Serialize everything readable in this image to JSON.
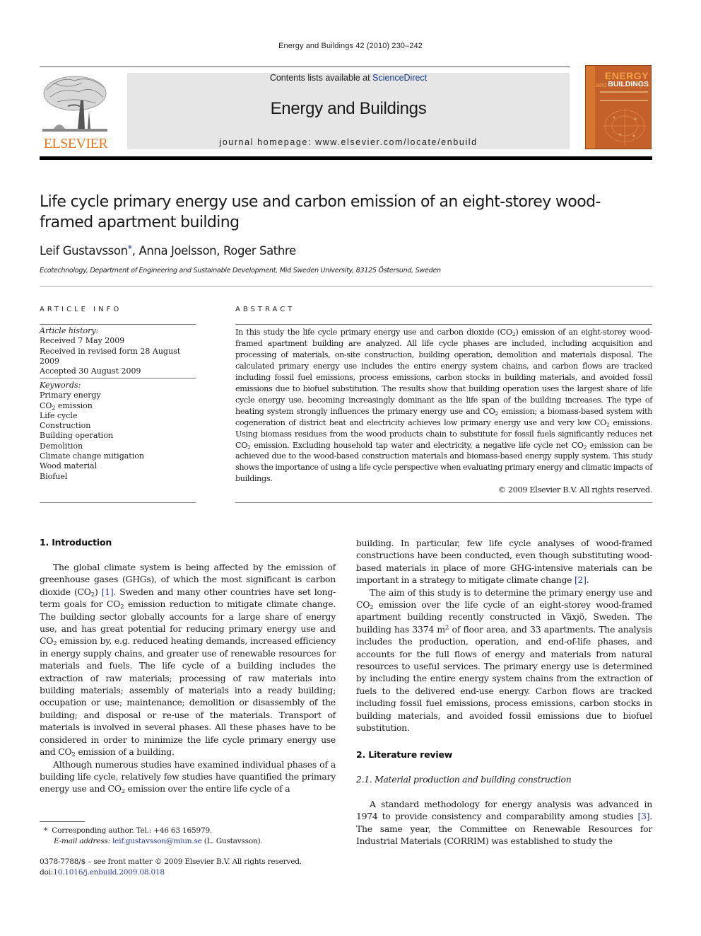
{
  "running_head": "Energy and Buildings 42 (2010) 230–242",
  "banner": {
    "contents_prefix": "Contents lists available at ",
    "contents_link": "ScienceDirect",
    "journal_title": "Energy and Buildings",
    "homepage": "journal homepage: www.elsevier.com/locate/enbuild"
  },
  "publisher_logo": {
    "icon": "elsevier-tree-icon",
    "wordmark": "ELSEVIER"
  },
  "cover": {
    "title_line1": "ENERGY",
    "title_and": "and",
    "title_line2": "BUILDINGS"
  },
  "article": {
    "title": "Life cycle primary energy use and carbon emission of an eight-storey wood-framed apartment building",
    "authors": [
      {
        "name": "Leif Gustavsson",
        "corresponding_mark": "*"
      },
      {
        "name": "Anna Joelsson"
      },
      {
        "name": "Roger Sathre"
      }
    ],
    "affiliation": "Ecotechnology, Department of Engineering and Sustainable Development, Mid Sweden University, 83125 Östersund, Sweden"
  },
  "article_info": {
    "label": "ARTICLE INFO",
    "history_label": "Article history:",
    "history": [
      "Received 7 May 2009",
      "Received in revised form 28 August 2009",
      "Accepted 30 August 2009"
    ],
    "keywords_label": "Keywords:",
    "keywords": [
      "Primary energy",
      "CO2 emission",
      "Life cycle",
      "Construction",
      "Building operation",
      "Demolition",
      "Climate change mitigation",
      "Wood material",
      "Biofuel"
    ]
  },
  "abstract": {
    "label": "ABSTRACT",
    "text": "In this study the life cycle primary energy use and carbon dioxide (CO2) emission of an eight-storey wood-framed apartment building are analyzed. All life cycle phases are included, including acquisition and processing of materials, on-site construction, building operation, demolition and materials disposal. The calculated primary energy use includes the entire energy system chains, and carbon flows are tracked including fossil fuel emissions, process emissions, carbon stocks in building materials, and avoided fossil emissions due to biofuel substitution. The results show that building operation uses the largest share of life cycle energy use, becoming increasingly dominant as the life span of the building increases. The type of heating system strongly influences the primary energy use and CO2 emission; a biomass-based system with cogeneration of district heat and electricity achieves low primary energy use and very low CO2 emissions. Using biomass residues from the wood products chain to substitute for fossil fuels significantly reduces net CO2 emission. Excluding household tap water and electricity, a negative life cycle net CO2 emission can be achieved due to the wood-based construction materials and biomass-based energy supply system. This study shows the importance of using a life cycle perspective when evaluating primary energy and climatic impacts of buildings.",
    "copyright": "© 2009 Elsevier B.V. All rights reserved."
  },
  "body": {
    "sec1_heading": "1.  Introduction",
    "sec1_p1": {
      "a": "The global climate system is being affected by the emission of greenhouse gases (GHGs), of which the most significant is carbon dioxide (CO",
      "b": ") ",
      "ref1": "[1]",
      "c": ". Sweden and many other countries have set long-term goals for CO",
      "d": " emission reduction to mitigate climate change. The building sector globally accounts for a large share of energy use, and has great potential for reducing primary energy use and CO",
      "e": " emission by, e.g. reduced heating demands, increased efficiency in energy supply chains, and greater use of renewable resources for materials and fuels. The life cycle of a building includes the extraction of raw materials; processing of raw materials into building materials; assembly of materials into a ready building; occupation or use; maintenance; demolition or disassembly of the building; and disposal or re-use of the materials. Transport of materials is involved in several phases. All these phases have to be considered in order to minimize the life cycle primary energy use and CO",
      "f": " emission of a building."
    },
    "sec1_p2": {
      "a": "Although numerous studies have examined individual phases of a building life cycle, relatively few studies have quantified the primary energy use and CO",
      "b": " emission over the entire life cycle of a building. In particular, few life cycle analyses of wood-framed constructions have been conducted, even though substituting wood-based materials in place of more GHG-intensive materials can be important in a strategy to mitigate climate change ",
      "ref2": "[2]",
      "c": "."
    },
    "sec1_p3": {
      "a": "The aim of this study is to determine the primary energy use and CO",
      "b": " emission over the life cycle of an eight-storey wood-framed apartment building recently constructed in Växjö, Sweden. The building has 3374 m",
      "c": " of floor area, and 33 apartments. The analysis includes the production, operation, and end-of-life phases, and accounts for the full flows of energy and materials from natural resources to useful services. The primary energy use is determined by including the entire energy system chains from the extraction of fuels to the delivered end-use energy. Carbon flows are tracked including fossil fuel emissions, process emissions, carbon stocks in building materials, and avoided fossil emissions due to biofuel substitution."
    },
    "sub_co2": "2",
    "sup_m2": "2",
    "sec2_heading": "2.  Literature review",
    "sec21_heading": "2.1.  Material production and building construction",
    "sec21_p1": {
      "a": "A standard methodology for energy analysis was advanced in 1974 to provide consistency and comparability among studies ",
      "ref3": "[3]",
      "b": ". The same year, the Committee on Renewable Resources for Industrial Materials (CORRIM) was established to study the"
    }
  },
  "footnotes": {
    "mark": "*",
    "corresponding": "Corresponding author. Tel.: +46 63 165979.",
    "email_label": "E-mail address:",
    "email": "leif.gustavsson@miun.se",
    "email_suffix": " (L. Gustavsson).",
    "front_matter": "0378-7788/$ – see front matter © 2009 Elsevier B.V. All rights reserved.",
    "doi_prefix": "doi:",
    "doi": "10.1016/j.enbuild.2009.08.018"
  },
  "colors": {
    "link": "#2a3c9a",
    "elsevier_orange": "#e87722",
    "cover_orange": "#c4602a",
    "banner_gray": "#e6e6e6"
  }
}
